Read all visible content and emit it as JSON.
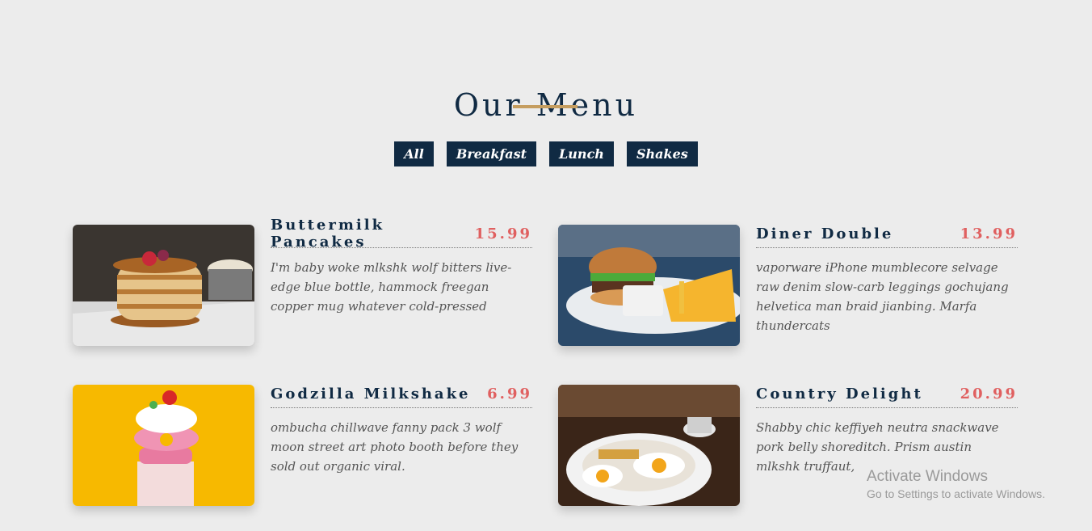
{
  "page": {
    "title": "Our Menu"
  },
  "filters": [
    "All",
    "Breakfast",
    "Lunch",
    "Shakes"
  ],
  "items": [
    {
      "name": "Buttermilk Pancakes",
      "price": "15.99",
      "desc": "I'm baby woke mlkshk wolf bitters live-edge blue bottle, hammock freegan copper mug whatever cold-pressed"
    },
    {
      "name": "Diner Double",
      "price": "13.99",
      "desc": "vaporware iPhone mumblecore selvage raw denim slow-carb leggings gochujang helvetica man braid jianbing. Marfa thundercats"
    },
    {
      "name": "Godzilla Milkshake",
      "price": "6.99",
      "desc": "ombucha chillwave fanny pack 3 wolf moon street art photo booth before they sold out organic viral."
    },
    {
      "name": "Country Delight",
      "price": "20.99",
      "desc": "Shabby chic keffiyeh neutra snackwave pork belly shoreditch. Prism austin mlkshk truffaut,"
    }
  ],
  "watermark": {
    "title": "Activate Windows",
    "subtitle": "Go to Settings to activate Windows."
  }
}
